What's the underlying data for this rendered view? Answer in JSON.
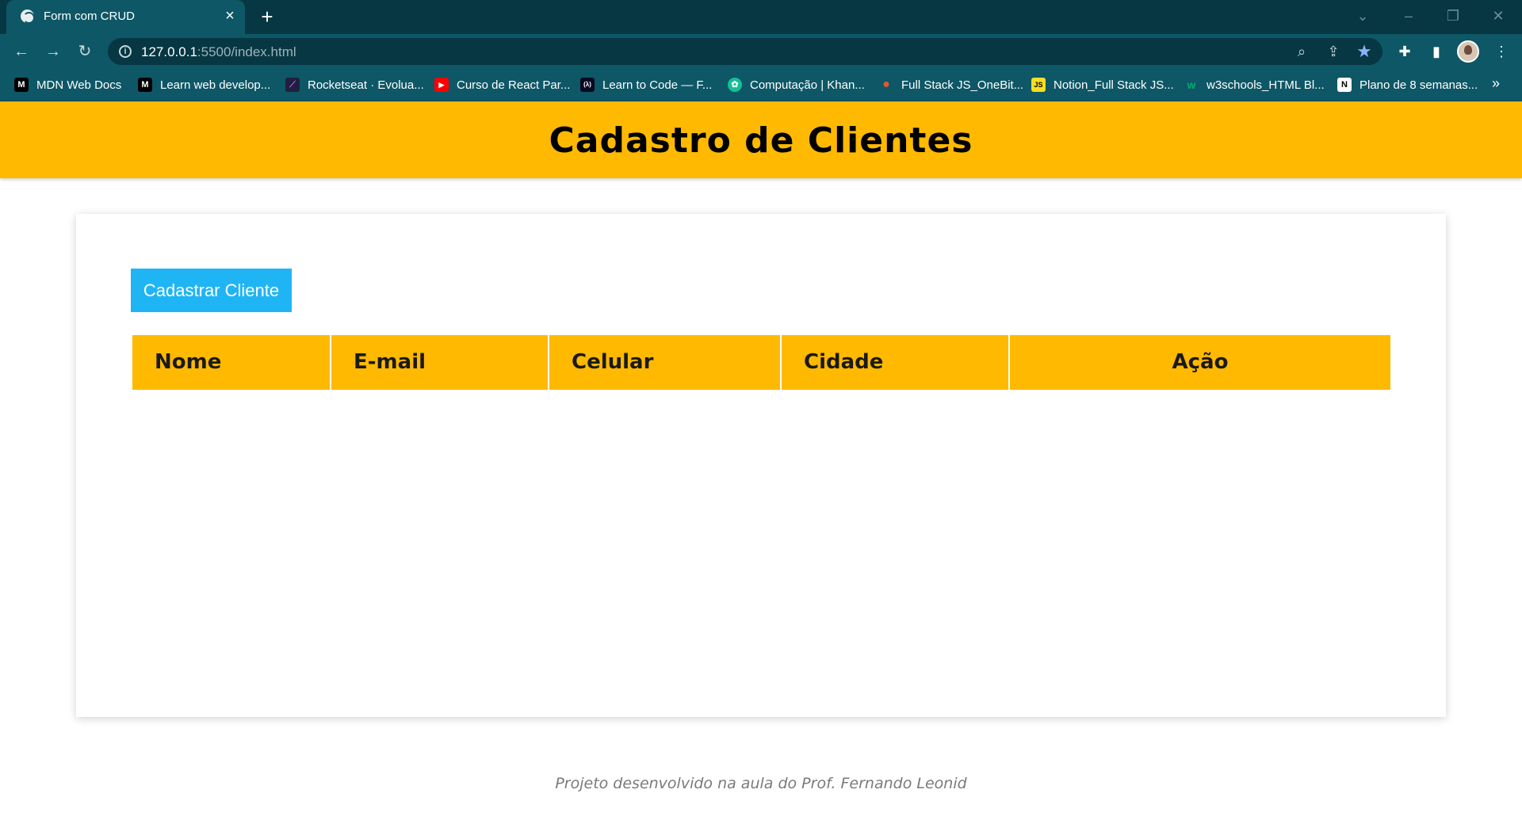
{
  "browser": {
    "tab_title": "Form com CRUD",
    "url_host": "127.0.0.1",
    "url_rest": ":5500/index.html",
    "bookmarks": [
      {
        "label": "MDN Web Docs",
        "icon": "mdn-icon",
        "color": "#000000",
        "glyph": "M"
      },
      {
        "label": "Learn web develop...",
        "icon": "mdn-icon",
        "color": "#000000",
        "glyph": "M"
      },
      {
        "label": "Rocketseat · Evolua...",
        "icon": "rocketseat-icon",
        "color": "#221f3c",
        "glyph": "⟋"
      },
      {
        "label": "Curso de React Par...",
        "icon": "youtube-icon",
        "color": "#ff0000",
        "glyph": "▶"
      },
      {
        "label": "Learn to Code — F...",
        "icon": "freecodecamp-icon",
        "color": "#0a0a23",
        "glyph": "(λ)"
      },
      {
        "label": "Computação | Khan...",
        "icon": "khan-academy-icon",
        "color": "#14bf96",
        "glyph": "✿"
      },
      {
        "label": "Full Stack JS_OneBit...",
        "icon": "onebitcode-icon",
        "color": "#e8542f",
        "glyph": "●"
      },
      {
        "label": "Notion_Full Stack JS...",
        "icon": "js-icon",
        "color": "#f7df1e",
        "glyph": "JS"
      },
      {
        "label": "w3schools_HTML Bl...",
        "icon": "w3schools-icon",
        "color": "#04aa6d",
        "glyph": "w"
      },
      {
        "label": "Plano de 8 semanas...",
        "icon": "notion-icon",
        "color": "#ffffff",
        "glyph": "N"
      }
    ]
  },
  "header": {
    "title": "Cadastro de Clientes"
  },
  "main": {
    "register_button": "Cadastrar Cliente",
    "columns": [
      "Nome",
      "E-mail",
      "Celular",
      "Cidade",
      "Ação"
    ]
  },
  "footer": {
    "text": "Projeto desenvolvido na aula do Prof. Fernando Leonid"
  },
  "colors": {
    "accent": "#ffb901",
    "button": "#1fb5f5",
    "chrome": "#0e5766"
  }
}
